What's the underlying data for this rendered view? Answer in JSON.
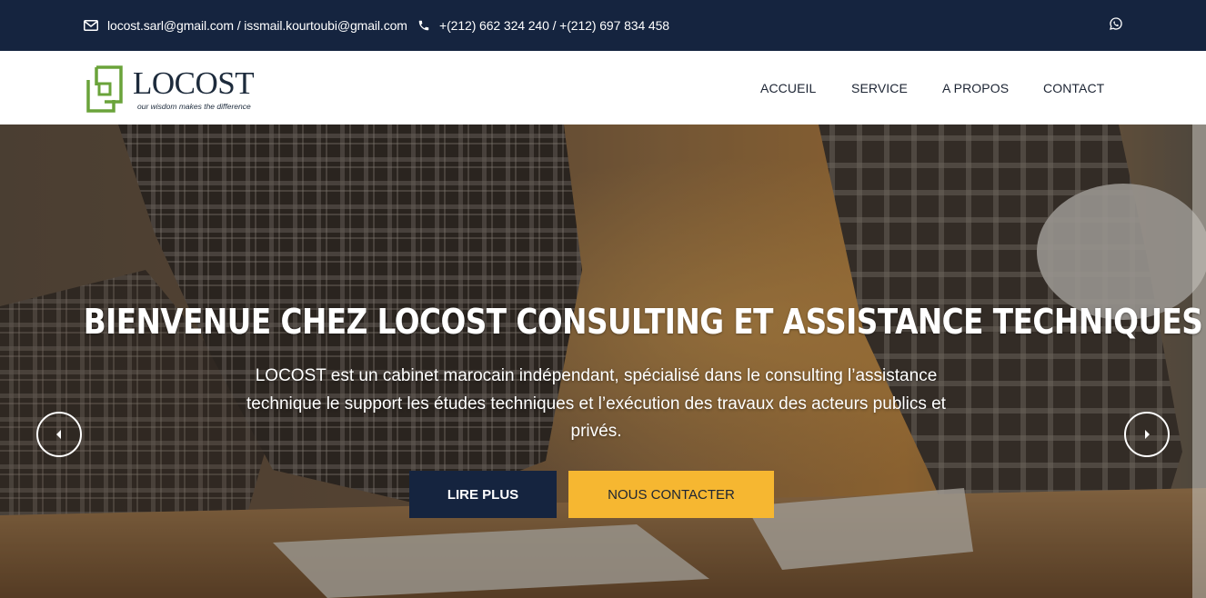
{
  "topbar": {
    "email": "locost.sarl@gmail.com / issmail.kourtoubi@gmail.com",
    "phone": "+(212) 662 324 240 / +(212) 697 834 458",
    "email_icon": "envelope-icon",
    "phone_icon": "phone-icon",
    "social_icon": "whatsapp-icon"
  },
  "logo": {
    "name": "LOCOST",
    "tagline": "our wisdom makes the difference"
  },
  "nav": {
    "items": [
      {
        "label": "ACCUEIL"
      },
      {
        "label": "SERVICE"
      },
      {
        "label": "A PROPOS"
      },
      {
        "label": "CONTACT"
      }
    ]
  },
  "hero": {
    "title": "BIENVENUE CHEZ LOCOST CONSULTING ET ASSISTANCE TECHNIQUES",
    "description": "LOCOST est un cabinet marocain indépendant, spécialisé dans le consulting l’assistance technique le support les études techniques et l’exécution des travaux des acteurs publics et privés.",
    "primary_button": "LIRE PLUS",
    "secondary_button": "NOUS CONTACTER",
    "prev_icon": "chevron-left-icon",
    "next_icon": "chevron-right-icon"
  },
  "colors": {
    "navy": "#15243f",
    "accent_yellow": "#f6b731",
    "logo_green": "#6aa33a",
    "text_dark": "#1c2433"
  }
}
